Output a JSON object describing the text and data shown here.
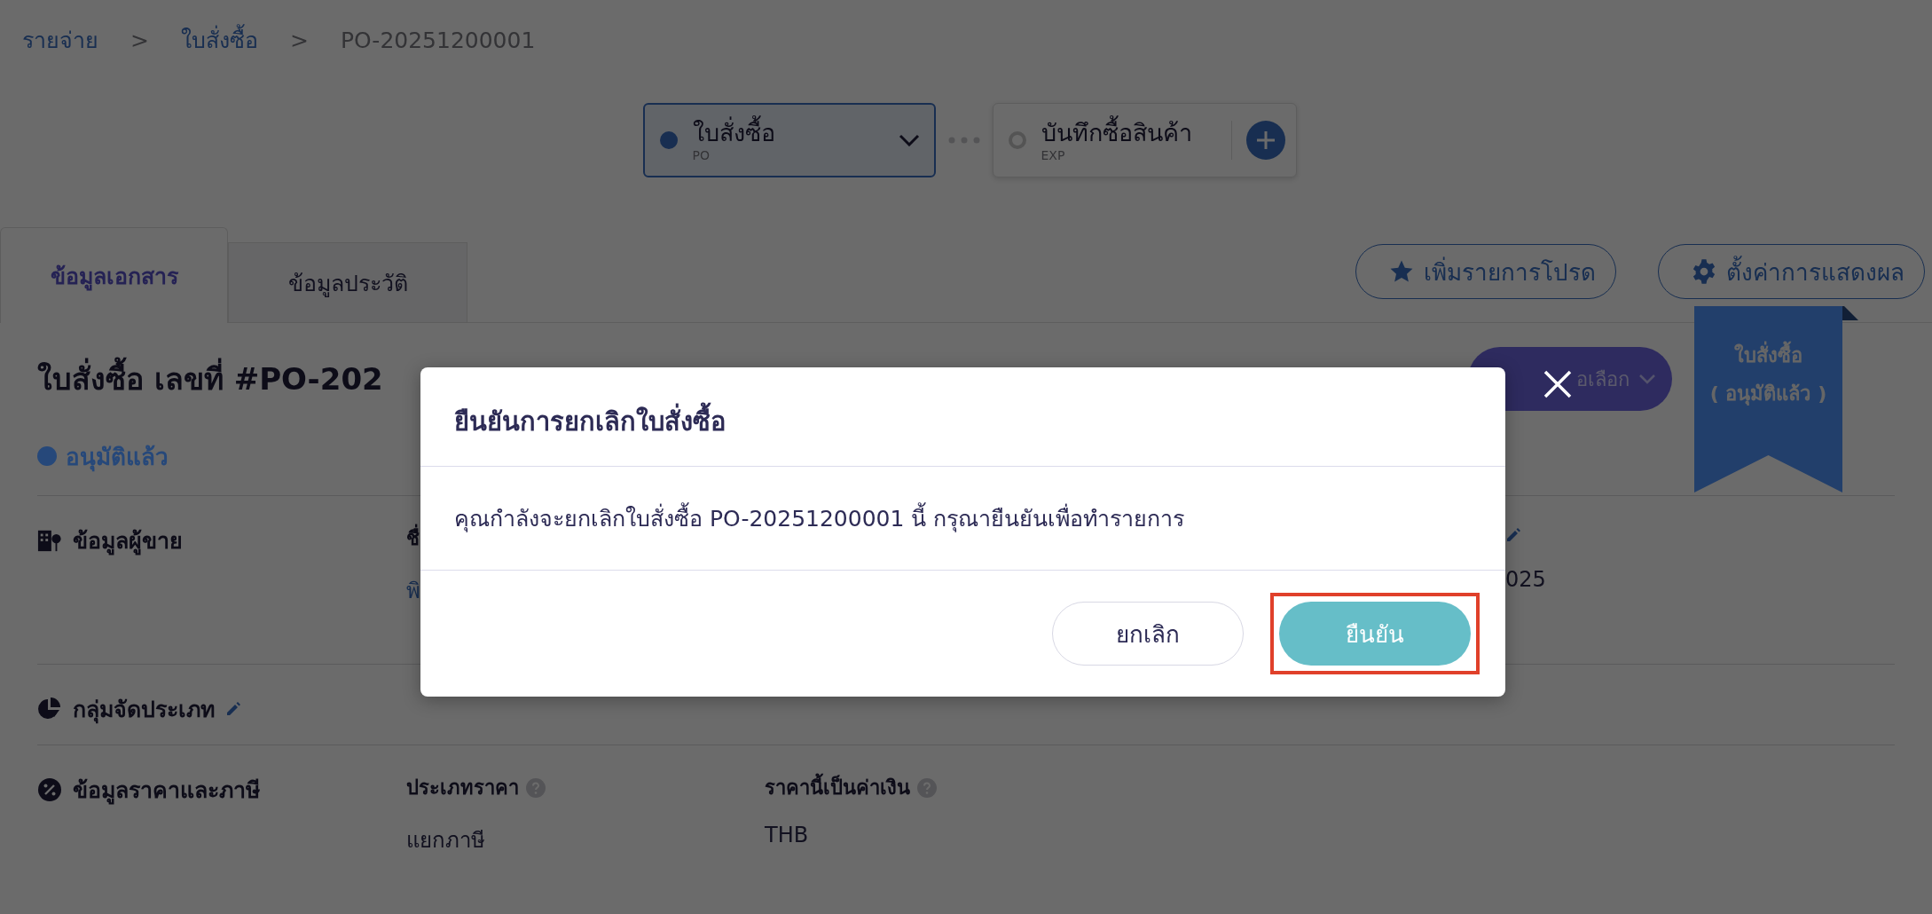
{
  "breadcrumb": [
    {
      "kind": "link",
      "text": "รายจ่าย"
    },
    {
      "kind": "separator",
      "text": ">"
    },
    {
      "kind": "link",
      "text": "ใบสั่งซื้อ"
    },
    {
      "kind": "separator",
      "text": ">"
    },
    {
      "kind": "current",
      "text": "PO-20251200001"
    }
  ],
  "document_flow": [
    {
      "title": "ใบสั่งซื้อ",
      "code": "PO",
      "selected": true
    },
    {
      "title": "บันทึกซื้อสินค้า",
      "code": "EXP",
      "selected": false
    }
  ],
  "tabs": [
    {
      "label": "ข้อมูลเอกสาร",
      "selected": true
    },
    {
      "label": "ข้อมูลประวัติ",
      "selected": false
    }
  ],
  "toolbar_buttons": [
    {
      "kind": "favorite",
      "label": "เพิ่มรายการโปรด"
    },
    {
      "kind": "settings",
      "label": "ตั้งค่าการแสดงผล"
    }
  ],
  "ribbon": {
    "title": "ใบสั่งซื้อ",
    "status": "( อนุมัติแล้ว )"
  },
  "document": {
    "title": "ใบสั่งซื้อ เลขที่ #PO-202",
    "options_button": "อเลือก",
    "status": {
      "label": "อนุมัติแล้ว",
      "color": "#26487a"
    }
  },
  "sections": [
    {
      "kind": "vendor",
      "title": "ข้อมูลผู้ขาย",
      "fields": [
        {
          "label": "ชื่",
          "value": "พิ",
          "link": true
        },
        {
          "value": "025",
          "editable": true
        }
      ]
    },
    {
      "kind": "category",
      "title": "กลุ่มจัดประเภท",
      "editable": true
    },
    {
      "kind": "price",
      "title": "ข้อมูลราคาและภาษี",
      "fields": [
        {
          "label": "ประเภทราคา",
          "value": "แยกภาษี",
          "help": true
        },
        {
          "label": "ราคานี้เป็นค่าเงิน",
          "value": "THB",
          "help": true
        }
      ]
    }
  ],
  "modal": {
    "title": "ยืนยันการยกเลิกใบสั่งซื้อ",
    "message": "คุณกำลังจะยกเลิกใบสั่งซื้อ PO-20251200001 นี้ กรุณายืนยันเพื่อทำรายการ",
    "buttons": [
      {
        "kind": "secondary",
        "label": "ยกเลิก"
      },
      {
        "kind": "primary",
        "label": "ยืนยัน",
        "highlighted": true
      }
    ]
  }
}
